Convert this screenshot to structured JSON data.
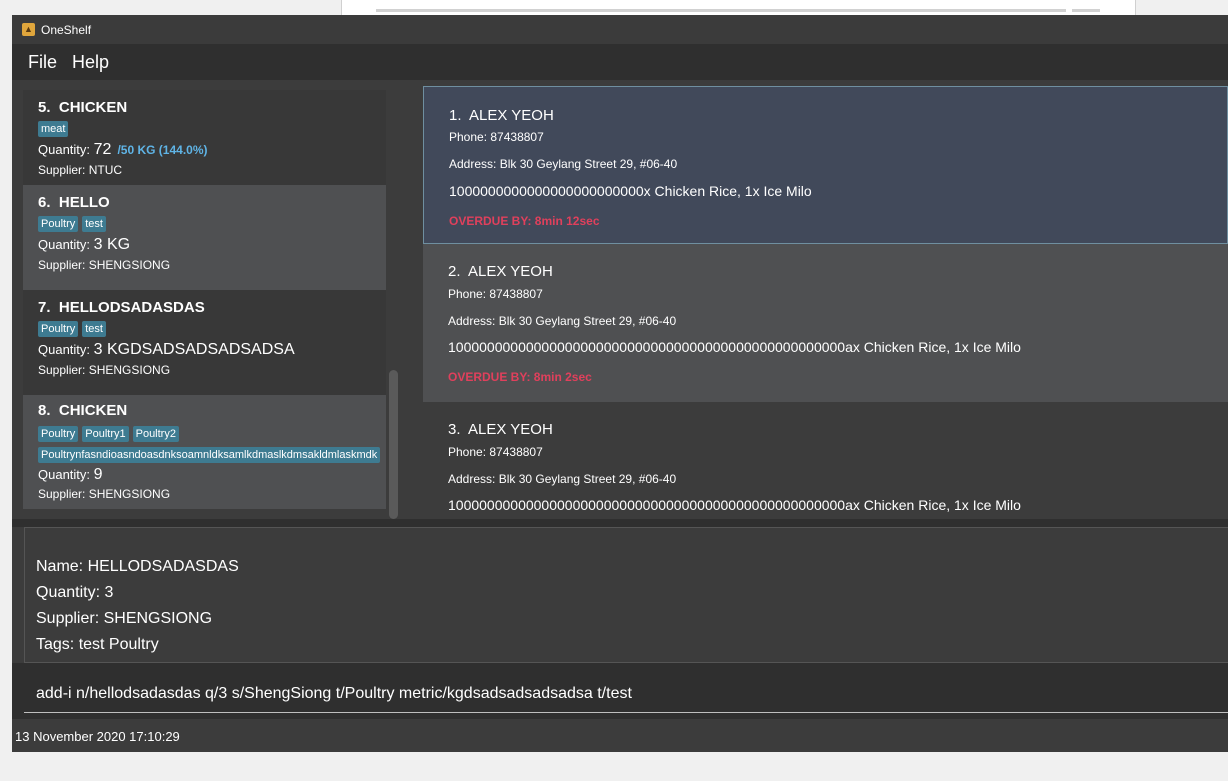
{
  "app": {
    "title": "OneShelf"
  },
  "menu": {
    "file": "File",
    "help": "Help"
  },
  "inventory": {
    "items": [
      {
        "index": "5.",
        "name": "CHICKEN",
        "tags": [
          "meat"
        ],
        "qty_label": "Quantity:",
        "qty": "72",
        "metric": "/50 KG (144.0%)",
        "supplier": "Supplier: NTUC"
      },
      {
        "index": "6.",
        "name": "HELLO",
        "tags": [
          "Poultry",
          "test"
        ],
        "qty_label": "Quantity:",
        "qty": "3 KG",
        "supplier": "Supplier: SHENGSIONG"
      },
      {
        "index": "7.",
        "name": "HELLODSADASDAS",
        "tags": [
          "Poultry",
          "test"
        ],
        "qty_label": "Quantity:",
        "qty": "3 KGDSADSADSADSADSA",
        "supplier": "Supplier: SHENGSIONG"
      },
      {
        "index": "8.",
        "name": "CHICKEN",
        "tags": [
          "Poultry",
          "Poultry1",
          "Poultry2"
        ],
        "tags_row2": [
          "Poultrynfasndioasndoasdnksoamnldksamlkdmaslkdmsakldmlaskmdk"
        ],
        "qty_label": "Quantity:",
        "qty": "9",
        "supplier": "Supplier: SHENGSIONG"
      }
    ]
  },
  "orders": [
    {
      "index": "1.",
      "name": "ALEX YEOH",
      "phone": "Phone: 87438807",
      "address": "Address: Blk 30 Geylang Street 29, #06-40",
      "detail": "1000000000000000000000000x Chicken Rice, 1x Ice Milo",
      "overdue": "OVERDUE BY: 8min 12sec"
    },
    {
      "index": "2.",
      "name": "ALEX YEOH",
      "phone": "Phone: 87438807",
      "address": "Address: Blk 30 Geylang Street 29, #06-40",
      "detail": "100000000000000000000000000000000000000000000000000ax Chicken Rice, 1x Ice Milo",
      "overdue": "OVERDUE BY: 8min 2sec"
    },
    {
      "index": "3.",
      "name": "ALEX YEOH",
      "phone": "Phone: 87438807",
      "address": "Address: Blk 30 Geylang Street 29, #06-40",
      "detail": "100000000000000000000000000000000000000000000000000ax Chicken Rice, 1x Ice Milo"
    }
  ],
  "details": {
    "name": "Name: HELLODSADASDAS",
    "quantity": "Quantity: 3",
    "supplier": "Supplier: SHENGSIONG",
    "tags": "Tags: test Poultry"
  },
  "command": {
    "value": "add-i n/hellodsadasdas q/3 s/ShengSiong t/Poultry metric/kgdsadsadsadsadsa t/test"
  },
  "status": {
    "datetime": "13 November 2020 17:10:29"
  },
  "colors": {
    "tag": "#3e7b91",
    "overdue": "#e0405c",
    "metric": "#5fb4e6",
    "selected_order": "#41495a"
  }
}
